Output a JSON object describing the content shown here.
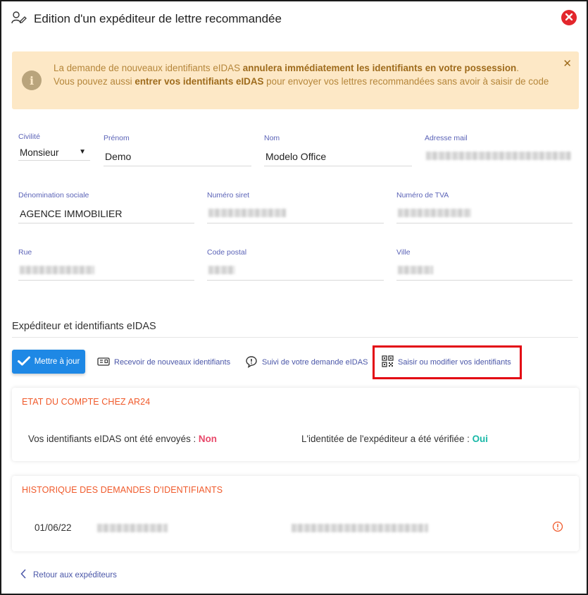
{
  "dialog": {
    "title": "Edition d'un expéditeur de lettre recommandée"
  },
  "alert": {
    "line1_part1": "La demande de nouveaux identifiants eIDAS ",
    "line1_bold": "annulera immédiatement les identifiants en votre possession",
    "line1_part2": ".",
    "line2_part1": "Vous pouvez aussi ",
    "line2_bold": "entrer vos identifiants eIDAS",
    "line2_part2": " pour envoyer vos lettres recommandées sans avoir à saisir de code"
  },
  "form": {
    "civility": {
      "label": "Civilité",
      "value": "Monsieur"
    },
    "firstname": {
      "label": "Prénom",
      "value": "Demo"
    },
    "lastname": {
      "label": "Nom",
      "value": "Modelo Office"
    },
    "email": {
      "label": "Adresse mail"
    },
    "company": {
      "label": "Dénomination sociale",
      "value": "AGENCE IMMOBILIER"
    },
    "siret": {
      "label": "Numéro siret"
    },
    "vat": {
      "label": "Numéro de TVA"
    },
    "street": {
      "label": "Rue"
    },
    "postal_code": {
      "label": "Code postal"
    },
    "city": {
      "label": "Ville"
    }
  },
  "eidas": {
    "section_title": "Expéditeur et identifiants eIDAS",
    "update_button": "Mettre à jour",
    "receive_link": "Recevoir de nouveaux identifiants",
    "follow_link": "Suivi de votre demande eIDAS",
    "enter_link": "Saisir ou modifier vos identifiants"
  },
  "account_state": {
    "title": "ETAT DU COMPTE CHEZ AR24",
    "sent_label": "Vos identifiants eIDAS ont été envoyés : ",
    "sent_value": "Non",
    "verified_label": "L'identitée de l'expéditeur a été vérifiée : ",
    "verified_value": "Oui"
  },
  "history": {
    "title": "HISTORIQUE DES DEMANDES D'IDENTIFIANTS",
    "rows": [
      {
        "date": "01/06/22"
      }
    ]
  },
  "footer": {
    "back_link": "Retour aux expéditeurs"
  },
  "colors": {
    "accent_blue": "#1e88e5",
    "label_purple": "#5b63b7",
    "alert_bg": "#fde8c6",
    "card_title_orange": "#f05a2b",
    "no_pink": "#e8486a",
    "yes_teal": "#18b8a7",
    "close_red": "#e3262c",
    "highlight_red": "#e30613"
  },
  "icons": {
    "header": "user-edit-icon",
    "close": "close-circle-icon",
    "alert": "info-icon",
    "update": "check-icon",
    "receive": "mail-card-icon",
    "follow": "alert-bubble-icon",
    "enter": "qr-code-icon",
    "history_info": "info-circle-icon",
    "back": "chevron-left-icon"
  }
}
